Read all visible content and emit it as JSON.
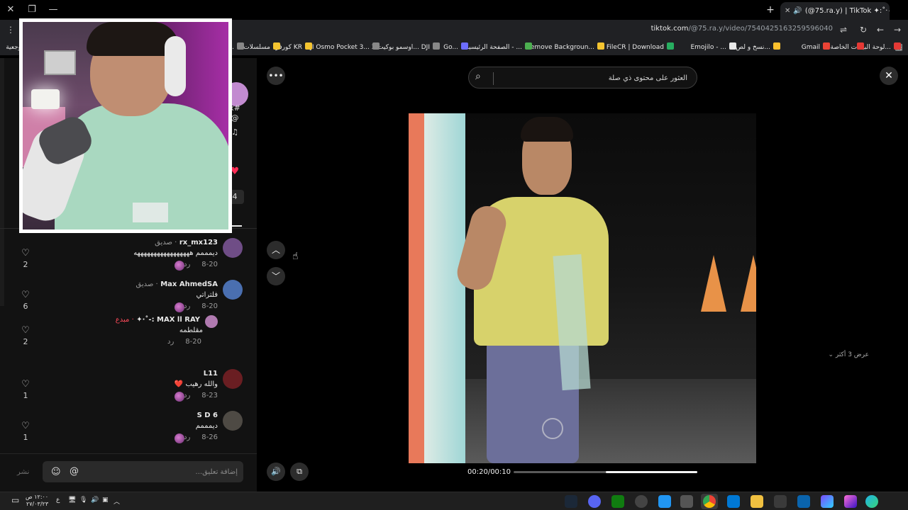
{
  "browser": {
    "tab_title": "(@75.ra.y) | TikTok ✦:˚·٠٧:",
    "url_host": "tiktok.com",
    "url_path": "/@75.ra.y/video/7540425163259596040",
    "new_tab_label": "+",
    "bookmarks": [
      {
        "label": "لوحة البيانات الخاصة...",
        "color": "#e53935"
      },
      {
        "label": "",
        "color": "#e53935"
      },
      {
        "label": "Gmail",
        "color": "#ea4335"
      },
      {
        "label": "نسخ و لص...",
        "color": "#fbc02d"
      },
      {
        "label": "Emojilo - ...",
        "color": "#e8e8e8"
      },
      {
        "label": "FileCR | Download",
        "color": "#27ae60"
      },
      {
        "label": "Remove Backgroun...",
        "color": "#f4c430"
      },
      {
        "label": "الصفحة الرئيسية - ...",
        "color": "#4caf50"
      },
      {
        "label": "Go...",
        "color": "#6d6dff"
      },
      {
        "label": "اوسمو بوكيت 3... DJI",
        "color": "#888"
      },
      {
        "label": "DJI Osmo Pocket 3...",
        "color": "#888"
      },
      {
        "label": "كورفر KR",
        "color": "#f4c430"
      },
      {
        "label": "مسلسلات",
        "color": "#f4c430"
      },
      {
        "label": "ytv jo...",
        "color": "#888"
      },
      {
        "label": "وجعية",
        "color": "#888"
      }
    ]
  },
  "video": {
    "search_placeholder": "العثور على محتوى ذي صلة",
    "time_display": "00:20/00:10",
    "progress_fraction": 0.5,
    "more_label": "•••",
    "close_label": "✕",
    "up_label": "︿",
    "down_label": "﹀",
    "mute_label": "🔊",
    "pip_label": "⧉"
  },
  "side_icons": [
    {
      "label": "x#"
    },
    {
      "label": "@"
    },
    {
      "label": "♫"
    },
    {
      "label": "♥"
    },
    {
      "label": "4"
    }
  ],
  "comments": [
    {
      "name": "rx_mx123",
      "tag": "· صديق",
      "tag_red": false,
      "text": "ديمممم هههههههههههههههههه",
      "date": "8-20",
      "reply": "رد",
      "likes": "2",
      "avatar_color": "#6f4d86"
    },
    {
      "name": "Max AhmedSA",
      "tag": "· صديق",
      "tag_red": false,
      "text": "فلتراتي",
      "date": "8-20",
      "reply": "رد",
      "likes": "6",
      "avatar_color": "#4a6fb0"
    },
    {
      "name": "MAX ll RAY :-˚·✦",
      "tag": "· مبدع",
      "tag_red": true,
      "text": "مقلطمه",
      "date": "8-20",
      "reply": "رد",
      "likes": "2",
      "avatar_color": "#b07ab0"
    },
    {
      "name": "L11",
      "tag": "",
      "tag_red": false,
      "text": "والله رهيب ❤️",
      "date": "8-23",
      "reply": "رد",
      "likes": "1",
      "avatar_color": "#6a1e22"
    },
    {
      "name": "S D 6",
      "tag": "",
      "tag_red": false,
      "text": "ديمممم",
      "date": "8-26",
      "reply": "رد",
      "likes": "1",
      "avatar_color": "#4e4a44"
    }
  ],
  "view_more_replies": "عرض 3 أكثر",
  "comment_box": {
    "placeholder": "إضافة تعليق...",
    "post_label": "نشر"
  },
  "taskbar": {
    "time": "١٢:٠٠ ص",
    "date": "٢٧/٠٣/٢٣",
    "lang": "ع"
  },
  "colors": {
    "accent_red": "#fe2c55",
    "panel_bg": "#121212",
    "page_bg": "#000000"
  }
}
